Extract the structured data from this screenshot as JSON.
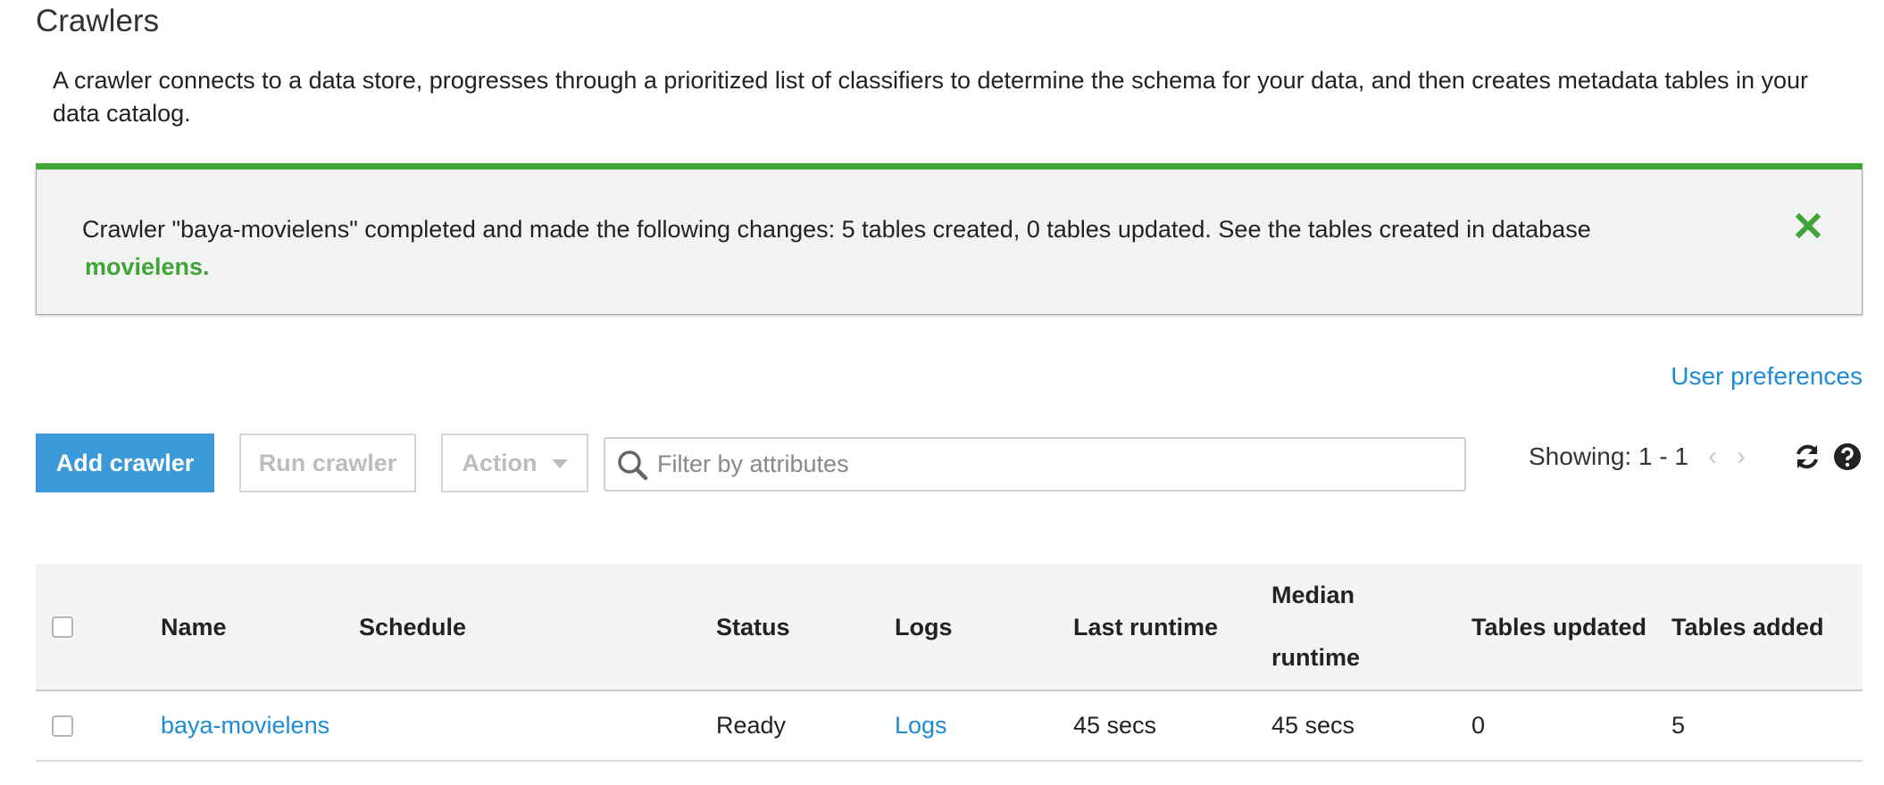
{
  "page": {
    "title": "Crawlers",
    "description": "A crawler connects to a data store, progresses through a prioritized list of classifiers to determine the schema for your data, and then creates metadata tables in your data catalog."
  },
  "flash": {
    "message": "Crawler \"baya-movielens\" completed and made the following changes: 5 tables created, 0 tables updated. See the tables created in database",
    "database_link": "movielens.",
    "accent_color": "#3fa535"
  },
  "user_preferences_label": "User preferences",
  "toolbar": {
    "add_label": "Add crawler",
    "run_label": "Run crawler",
    "action_label": "Action",
    "search_placeholder": "Filter by attributes",
    "showing_text": "Showing: 1 - 1",
    "primary_color": "#3a9ad9"
  },
  "table": {
    "columns": {
      "name": "Name",
      "schedule": "Schedule",
      "status": "Status",
      "logs": "Logs",
      "last_runtime": "Last runtime",
      "median_runtime_line1": "Median",
      "median_runtime_line2": "runtime",
      "tables_updated": "Tables updated",
      "tables_added": "Tables added"
    },
    "rows": [
      {
        "name": "baya-movielens",
        "schedule": "",
        "status": "Ready",
        "logs": "Logs",
        "last_runtime": "45 secs",
        "median_runtime": "45 secs",
        "tables_updated": "0",
        "tables_added": "5"
      }
    ]
  },
  "icons": {
    "close": "close-icon",
    "search": "search-icon",
    "prev": "chevron-left-icon",
    "next": "chevron-right-icon",
    "refresh": "refresh-icon",
    "help": "help-icon"
  }
}
